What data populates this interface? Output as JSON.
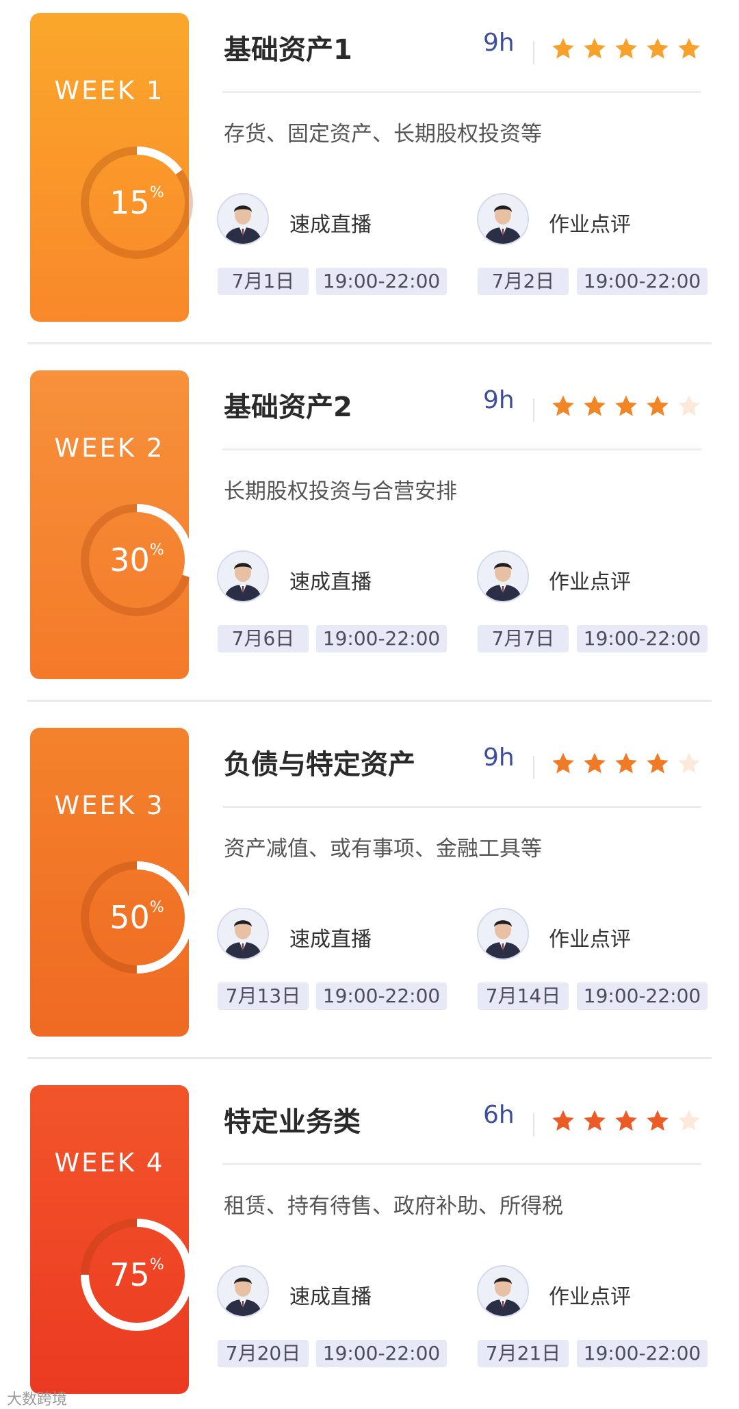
{
  "weeks": [
    {
      "week_label": "WEEK 1",
      "percent": 15,
      "percent_text": "15",
      "title": "基础资产1",
      "hours": "9h",
      "rating": 5,
      "subtitle": "存货、固定资产、长期股权投资等",
      "live": {
        "label": "速成直播",
        "date": "7月1日",
        "time": "19:00-22:00"
      },
      "review": {
        "label": "作业点评",
        "date": "7月2日",
        "time": "19:00-22:00"
      },
      "color_top": "#FAA72B",
      "color_bottom": "#F9882A"
    },
    {
      "week_label": "WEEK 2",
      "percent": 30,
      "percent_text": "30",
      "title": "基础资产2",
      "hours": "9h",
      "rating": 4,
      "subtitle": "长期股权投资与合营安排",
      "live": {
        "label": "速成直播",
        "date": "7月6日",
        "time": "19:00-22:00"
      },
      "review": {
        "label": "作业点评",
        "date": "7月7日",
        "time": "19:00-22:00"
      },
      "color_top": "#F7913B",
      "color_bottom": "#F47A2A"
    },
    {
      "week_label": "WEEK 3",
      "percent": 50,
      "percent_text": "50",
      "title": "负债与特定资产",
      "hours": "9h",
      "rating": 4,
      "subtitle": "资产减值、或有事项、金融工具等",
      "live": {
        "label": "速成直播",
        "date": "7月13日",
        "time": "19:00-22:00"
      },
      "review": {
        "label": "作业点评",
        "date": "7月14日",
        "time": "19:00-22:00"
      },
      "color_top": "#F4822C",
      "color_bottom": "#EF6A22"
    },
    {
      "week_label": "WEEK 4",
      "percent": 75,
      "percent_text": "75",
      "title": "特定业务类",
      "hours": "6h",
      "rating": 4,
      "subtitle": "租赁、持有待售、政府补助、所得税",
      "live": {
        "label": "速成直播",
        "date": "7月20日",
        "time": "19:00-22:00"
      },
      "review": {
        "label": "作业点评",
        "date": "7月21日",
        "time": "19:00-22:00"
      },
      "color_top": "#F2552A",
      "color_bottom": "#EB3A22"
    }
  ],
  "percent_sign": "%",
  "star_on_colors": [
    "#F7A12A",
    "#F28627",
    "#F07A26",
    "#EC5A26"
  ],
  "star_off_color": "#FDE9DA",
  "watermark": "大数跨境"
}
